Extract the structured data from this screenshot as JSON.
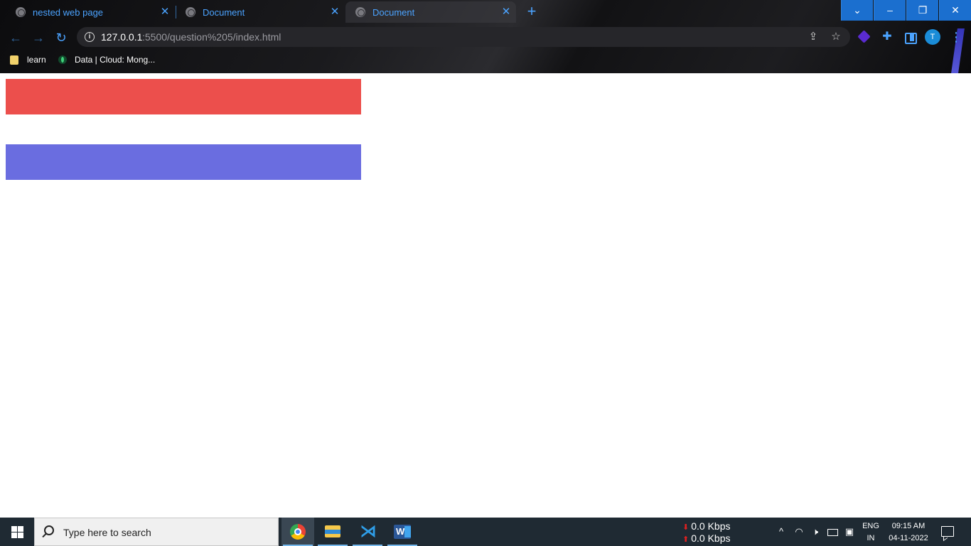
{
  "browser": {
    "tabs": [
      {
        "title": "nested web page",
        "active": false
      },
      {
        "title": "Document",
        "active": false
      },
      {
        "title": "Document",
        "active": true
      }
    ],
    "new_tab_label": "+",
    "url_host": "127.0.0.1",
    "url_path": ":5500/question%205/index.html",
    "avatar_initial": "T",
    "bookmarks": [
      {
        "label": "learn",
        "icon": "folder-icon"
      },
      {
        "label": "Data | Cloud: Mong...",
        "icon": "mongodb-leaf-icon"
      }
    ],
    "accent_color": "#4ba3ff"
  },
  "page": {
    "boxes": [
      {
        "name": "red-box",
        "color": "#ec4f4c"
      },
      {
        "name": "blue-box",
        "color": "#6a6de0"
      }
    ]
  },
  "taskbar": {
    "search_placeholder": "Type here to search",
    "pinned_apps": [
      "Google Chrome",
      "File Explorer",
      "Visual Studio Code",
      "Microsoft Word"
    ],
    "network": {
      "down": "0.0 Kbps",
      "up": "0.0 Kbps"
    },
    "language": {
      "line1": "ENG",
      "line2": "IN"
    },
    "clock": {
      "time": "09:15 AM",
      "date": "04-11-2022"
    }
  }
}
